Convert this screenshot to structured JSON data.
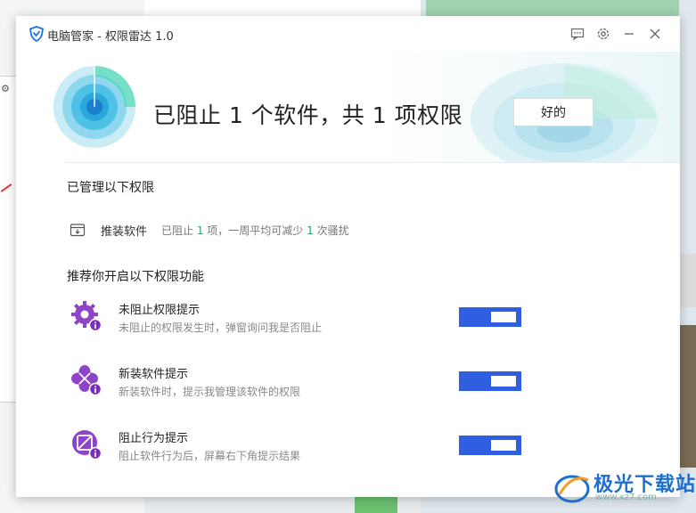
{
  "window": {
    "title": "电脑管家 - 权限雷达 1.0"
  },
  "header": {
    "headline": "已阻止 1 个软件，共 1 项权限",
    "ok_label": "好的"
  },
  "managed": {
    "section_title": "已管理以下权限",
    "items": [
      {
        "name": "推装软件",
        "desc_prefix": "已阻止 ",
        "blocked_count": "1",
        "desc_middle": " 项，一周平均可减少 ",
        "reduce_count": "1",
        "desc_suffix": " 次骚扰"
      }
    ]
  },
  "recommend": {
    "section_title": "推荐你开启以下权限功能",
    "features": [
      {
        "name": "未阻止权限提示",
        "desc": "未阻止的权限发生时，弹窗询问我是否阻止",
        "icon": "gear-info-icon",
        "enabled": false
      },
      {
        "name": "新装软件提示",
        "desc": "新装软件时，提示我管理该软件的权限",
        "icon": "clover-info-icon",
        "enabled": false
      },
      {
        "name": "阻止行为提示",
        "desc": "阻止软件行为后，屏幕右下角提示结果",
        "icon": "block-info-icon",
        "enabled": false
      }
    ]
  },
  "watermark": {
    "text": "极光下载站",
    "sub": "www.xz7.com"
  },
  "colors": {
    "accent": "#2f5fe0",
    "highlight_number": "#27a36a",
    "icon_purple": "#8e44c8"
  },
  "icons": {
    "app_logo": "shield-icon",
    "feedback": "message-icon",
    "settings": "gear-icon",
    "minimize": "minimize-icon",
    "close": "close-icon",
    "managed_item": "box-download-icon"
  }
}
